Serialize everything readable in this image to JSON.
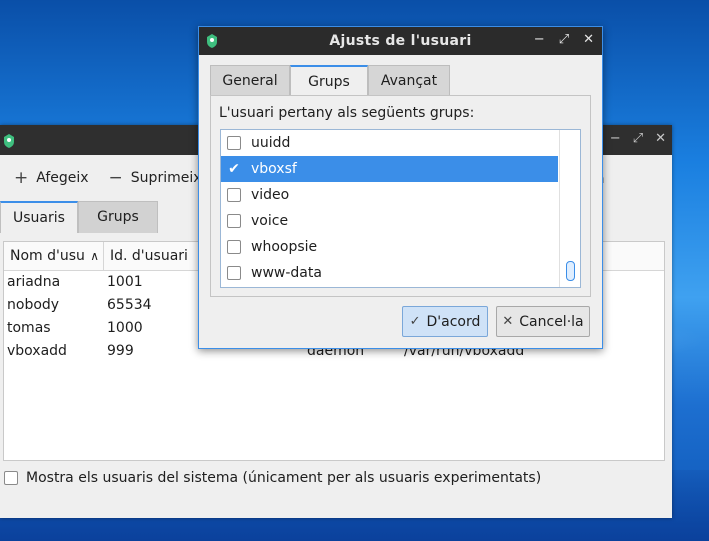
{
  "back_window": {
    "toolbar": {
      "add_label": "Afegeix",
      "remove_label": "Suprimeix",
      "right_partial": "a"
    },
    "tabs": [
      {
        "label": "Usuaris",
        "active": true
      },
      {
        "label": "Grups",
        "active": false
      }
    ],
    "columns": [
      "Nom d'usu",
      "Id. d'usuari"
    ],
    "rows": [
      {
        "name": "ariadna",
        "id": "1001",
        "group": "",
        "home": ""
      },
      {
        "name": "nobody",
        "id": "65534",
        "group": "",
        "home": ""
      },
      {
        "name": "tomas",
        "id": "1000",
        "group": "",
        "home": ""
      },
      {
        "name": "vboxadd",
        "id": "999",
        "group": "daemon",
        "home": "/var/run/vboxadd"
      }
    ],
    "show_system_label": "Mostra els usuaris del sistema (únicament per als usuaris experimentats)"
  },
  "dialog": {
    "title": "Ajusts de l'usuari",
    "tabs": [
      {
        "label": "General",
        "active": false
      },
      {
        "label": "Grups",
        "active": true
      },
      {
        "label": "Avançat",
        "active": false
      }
    ],
    "groups_label": "L'usuari pertany als següents grups:",
    "groups": [
      {
        "name": "uuidd",
        "checked": false,
        "selected": false
      },
      {
        "name": "vboxsf",
        "checked": true,
        "selected": true
      },
      {
        "name": "video",
        "checked": false,
        "selected": false
      },
      {
        "name": "voice",
        "checked": false,
        "selected": false
      },
      {
        "name": "whoopsie",
        "checked": false,
        "selected": false
      },
      {
        "name": "www-data",
        "checked": false,
        "selected": false
      }
    ],
    "ok_label": "D'acord",
    "cancel_label": "Cancel·la"
  },
  "colors": {
    "accent": "#3b8ee8",
    "titlebar": "#2b2b2b"
  }
}
